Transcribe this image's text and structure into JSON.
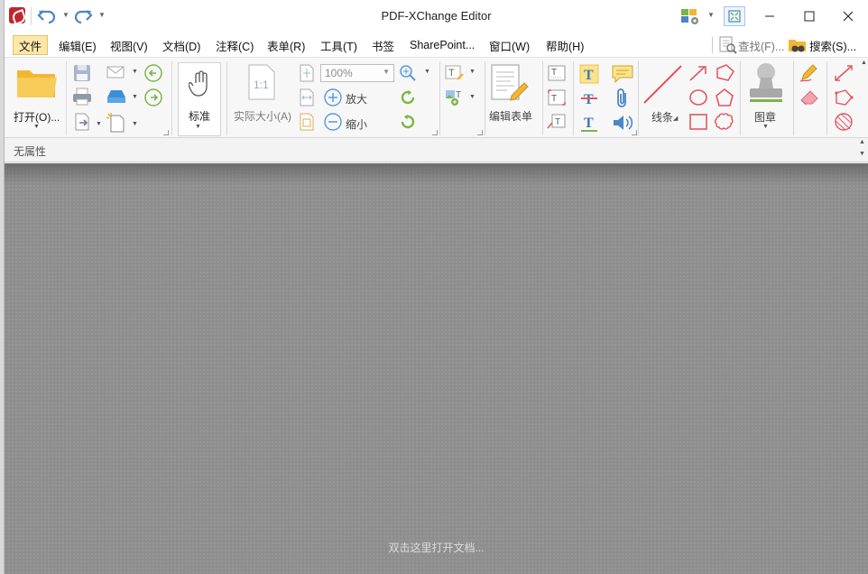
{
  "window": {
    "title": "PDF-XChange Editor"
  },
  "menu": {
    "items": [
      {
        "label": "文件",
        "active": true
      },
      {
        "label": "编辑(E)"
      },
      {
        "label": "视图(V)"
      },
      {
        "label": "文档(D)"
      },
      {
        "label": "注释(C)"
      },
      {
        "label": "表单(R)"
      },
      {
        "label": "工具(T)"
      },
      {
        "label": "书签"
      },
      {
        "label": "SharePoint..."
      },
      {
        "label": "窗口(W)"
      },
      {
        "label": "帮助(H)"
      }
    ],
    "find_label": "查找(F)...",
    "search_label": "搜索(S)..."
  },
  "ribbon": {
    "open_label": "打开(O)...",
    "hand_label": "标准",
    "actual_size_label": "实际大小(A)",
    "zoom_value": "100%",
    "zoom_in_label": "放大",
    "zoom_out_label": "缩小",
    "edit_form_label": "编辑表单",
    "lines_label": "线条",
    "stamp_label": "图章"
  },
  "property_bar": {
    "text": "无属性"
  },
  "document": {
    "hint": "双击这里打开文档..."
  },
  "colors": {
    "accent": "#4a86c8",
    "menu_active_bg": "#fbe7a8",
    "annotation_red": "#e5555f",
    "text_yellow": "#f2d54a"
  }
}
